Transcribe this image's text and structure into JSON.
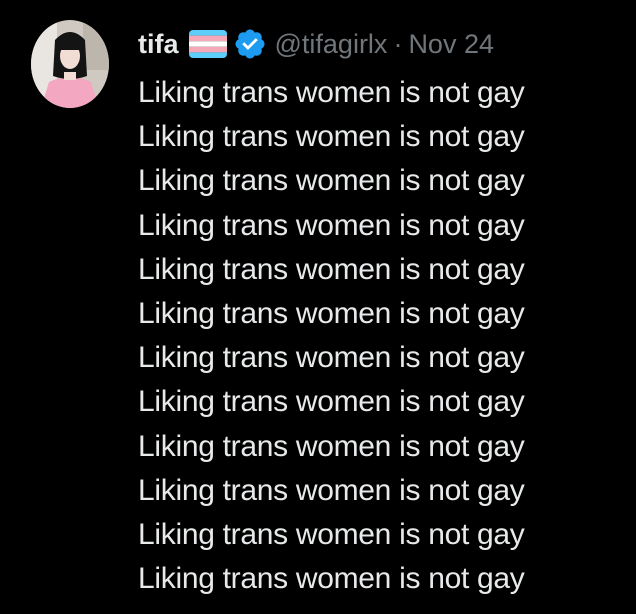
{
  "tweet": {
    "author": {
      "display_name": "tifa",
      "handle": "@tifagirlx",
      "avatar_icon": "profile-photo",
      "flag_icon": "transgender-flag-icon",
      "verified_icon": "verified-badge-icon",
      "verified_color": "#1d9bf0"
    },
    "separator": "·",
    "date": "Nov 24",
    "lines": [
      "Liking trans women is not gay",
      "Liking trans women is not gay",
      "Liking trans women is not gay",
      "Liking trans women is not gay",
      "Liking trans women is not gay",
      "Liking trans women is not gay",
      "Liking trans women is not gay",
      "Liking trans women is not gay",
      "Liking trans women is not gay",
      "Liking trans women is not gay",
      "Liking trans women is not gay",
      "Liking trans women is not gay"
    ]
  },
  "colors": {
    "background": "#000000",
    "text_primary": "#e7e9ea",
    "text_secondary": "#71767b",
    "flag_blue": "#5bcefa",
    "flag_pink": "#f5a9b8",
    "flag_white": "#ffffff"
  }
}
